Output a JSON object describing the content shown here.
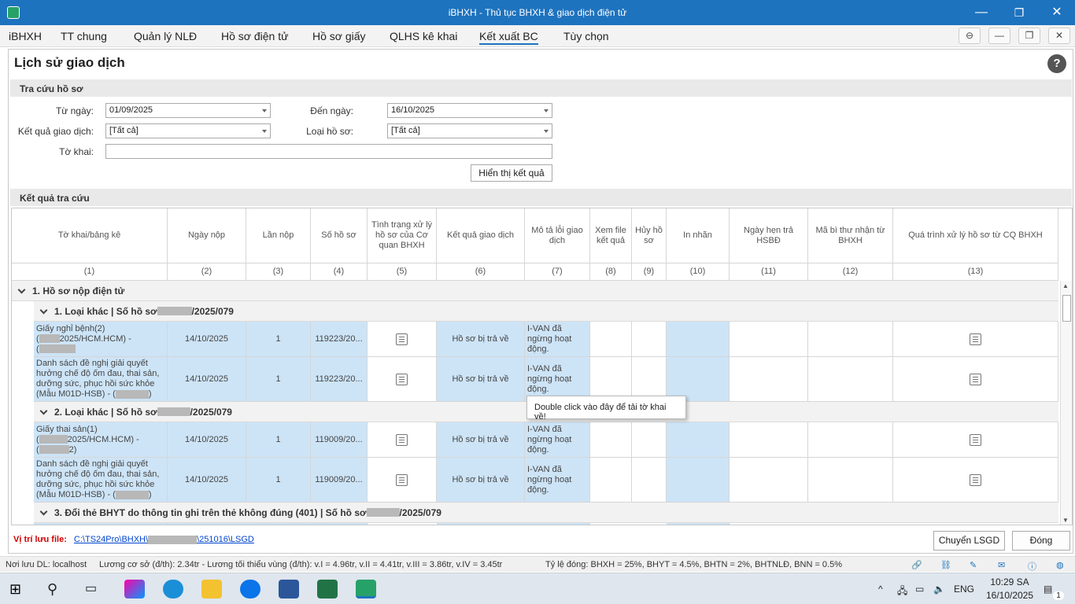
{
  "window": {
    "title": "iBHXH - Thủ tục BHXH & giao dịch điện tử",
    "min": "—",
    "max": "❐",
    "close": "✕"
  },
  "menu": {
    "items": [
      "iBHXH",
      "TT chung",
      "Quản lý NLĐ",
      "Hồ sơ điện tử",
      "Hồ sơ giấy",
      "QLHS kê khai",
      "Kết xuất BC",
      "Tùy chọn"
    ],
    "active_index": 6,
    "right_buttons": [
      "⊖",
      "—",
      "❐",
      "✕"
    ]
  },
  "page": {
    "title": "Lịch sử giao dịch",
    "help": "?"
  },
  "search": {
    "heading": "Tra cứu hồ sơ",
    "from_label": "Từ ngày:",
    "from_value": "01/09/2025",
    "to_label": "Đến ngày:",
    "to_value": "16/10/2025",
    "result_label": "Kết quả giao dịch:",
    "result_value": "[Tất cả]",
    "type_label": "Loại hồ sơ:",
    "type_value": "[Tất cả]",
    "form_label": "Tờ khai:",
    "form_value": "",
    "show_button": "Hiển thị kết quả"
  },
  "results": {
    "heading": "Kết quả tra cứu",
    "columns": [
      "Tờ khai/bảng kê",
      "Ngày nộp",
      "Lần nộp",
      "Số hồ sơ",
      "Tình trạng xử lý hồ sơ của Cơ quan BHXH",
      "Kết quả giao dịch",
      "Mô tả lỗi giao dịch",
      "Xem file kết quả",
      "Hủy hồ sơ",
      "In nhãn",
      "Ngày hẹn trả HSBĐ",
      "Mã bì thư nhận từ BHXH",
      "Quá trình xử lý hồ sơ từ CQ BHXH"
    ],
    "col_numbers": [
      "(1)",
      "(2)",
      "(3)",
      "(4)",
      "(5)",
      "(6)",
      "(7)",
      "(8)",
      "(9)",
      "(10)",
      "(11)",
      "(12)",
      "(13)"
    ],
    "top_group": "1. Hồ sơ nộp điện tử",
    "groups": [
      {
        "prefix": "1. Loại khác | Số hồ sơ ",
        "suffix": "/2025/079"
      },
      {
        "prefix": "2. Loại khác | Số hồ sơ ",
        "suffix": "/2025/079"
      },
      {
        "prefix": "3. Đổi thẻ BHYT do thông tin ghi trên thẻ không đúng (401) | Số hồ sơ ",
        "suffix": "/2025/079"
      }
    ],
    "rows": [
      {
        "l1": "Giấy nghỉ bệnh(2)",
        "l2a": "(",
        "l2b": "2025/HCM.HCM) -",
        "l3": "(",
        "date": "14/10/2025",
        "count": "1",
        "num": "119223/20...",
        "result": "Hồ sơ bị trả về",
        "error": "I-VAN đã ngừng hoạt động."
      },
      {
        "l1": "Danh sách đề nghị giải quyết hưởng chế độ ốm đau, thai sản, dưỡng sức, phục hồi sức khỏe (Mẫu M01D-HSB) - (",
        "l2a": ")",
        "date": "14/10/2025",
        "count": "1",
        "num": "119223/20...",
        "result": "Hồ sơ bị trả về",
        "error": "I-VAN đã ngừng hoạt động."
      },
      {
        "l1": "Giấy thai sản(1)",
        "l2a": "(",
        "l2b": "2025/HCM.HCM) -",
        "l3": "(",
        "l3b": "2)",
        "date": "14/10/2025",
        "count": "1",
        "num": "119009/20...",
        "result": "Hồ sơ bị trả về",
        "error": "I-VAN đã ngừng hoạt động."
      },
      {
        "l1": "Danh sách đề nghị giải quyết hưởng chế độ ốm đau, thai sản, dưỡng sức, phục hồi sức khỏe (Mẫu M01D-HSB) - (",
        "l2a": ")",
        "date": "14/10/2025",
        "count": "1",
        "num": "119009/20...",
        "result": "Hồ sơ bị trả về",
        "error": "I-VAN đã ngừng hoạt động."
      }
    ],
    "tooltip": "Double click vào đây để tải tờ khai về!"
  },
  "footer": {
    "save_label": "Vị trí lưu file:",
    "path_a": "C:\\TS24Pro\\BHXH\\",
    "path_b": "\\251016\\LSGD",
    "transfer_button": "Chuyển LSGD",
    "close_button": "Đóng"
  },
  "status": {
    "location": "Nơi lưu DL: localhost",
    "salary": "Lương cơ sở (đ/th): 2.34tr - Lương tối thiểu vùng (đ/th): v.I =  4.96tr, v.II = 4.41tr, v.III = 3.86tr, v.IV = 3.45tr",
    "rates": "Tỷ lệ đóng: BHXH = 25%, BHYT = 4.5%, BHTN = 2%, BHTNLĐ, BNN = 0.5%"
  },
  "taskbar": {
    "lang": "ENG",
    "time": "10:29 SA",
    "date": "16/10/2025",
    "notif_count": "1"
  },
  "colors": {
    "titlebar": "#1e73be",
    "selected_cell": "#cde4f7",
    "footer_label": "#d00000",
    "link": "#0044cc"
  }
}
